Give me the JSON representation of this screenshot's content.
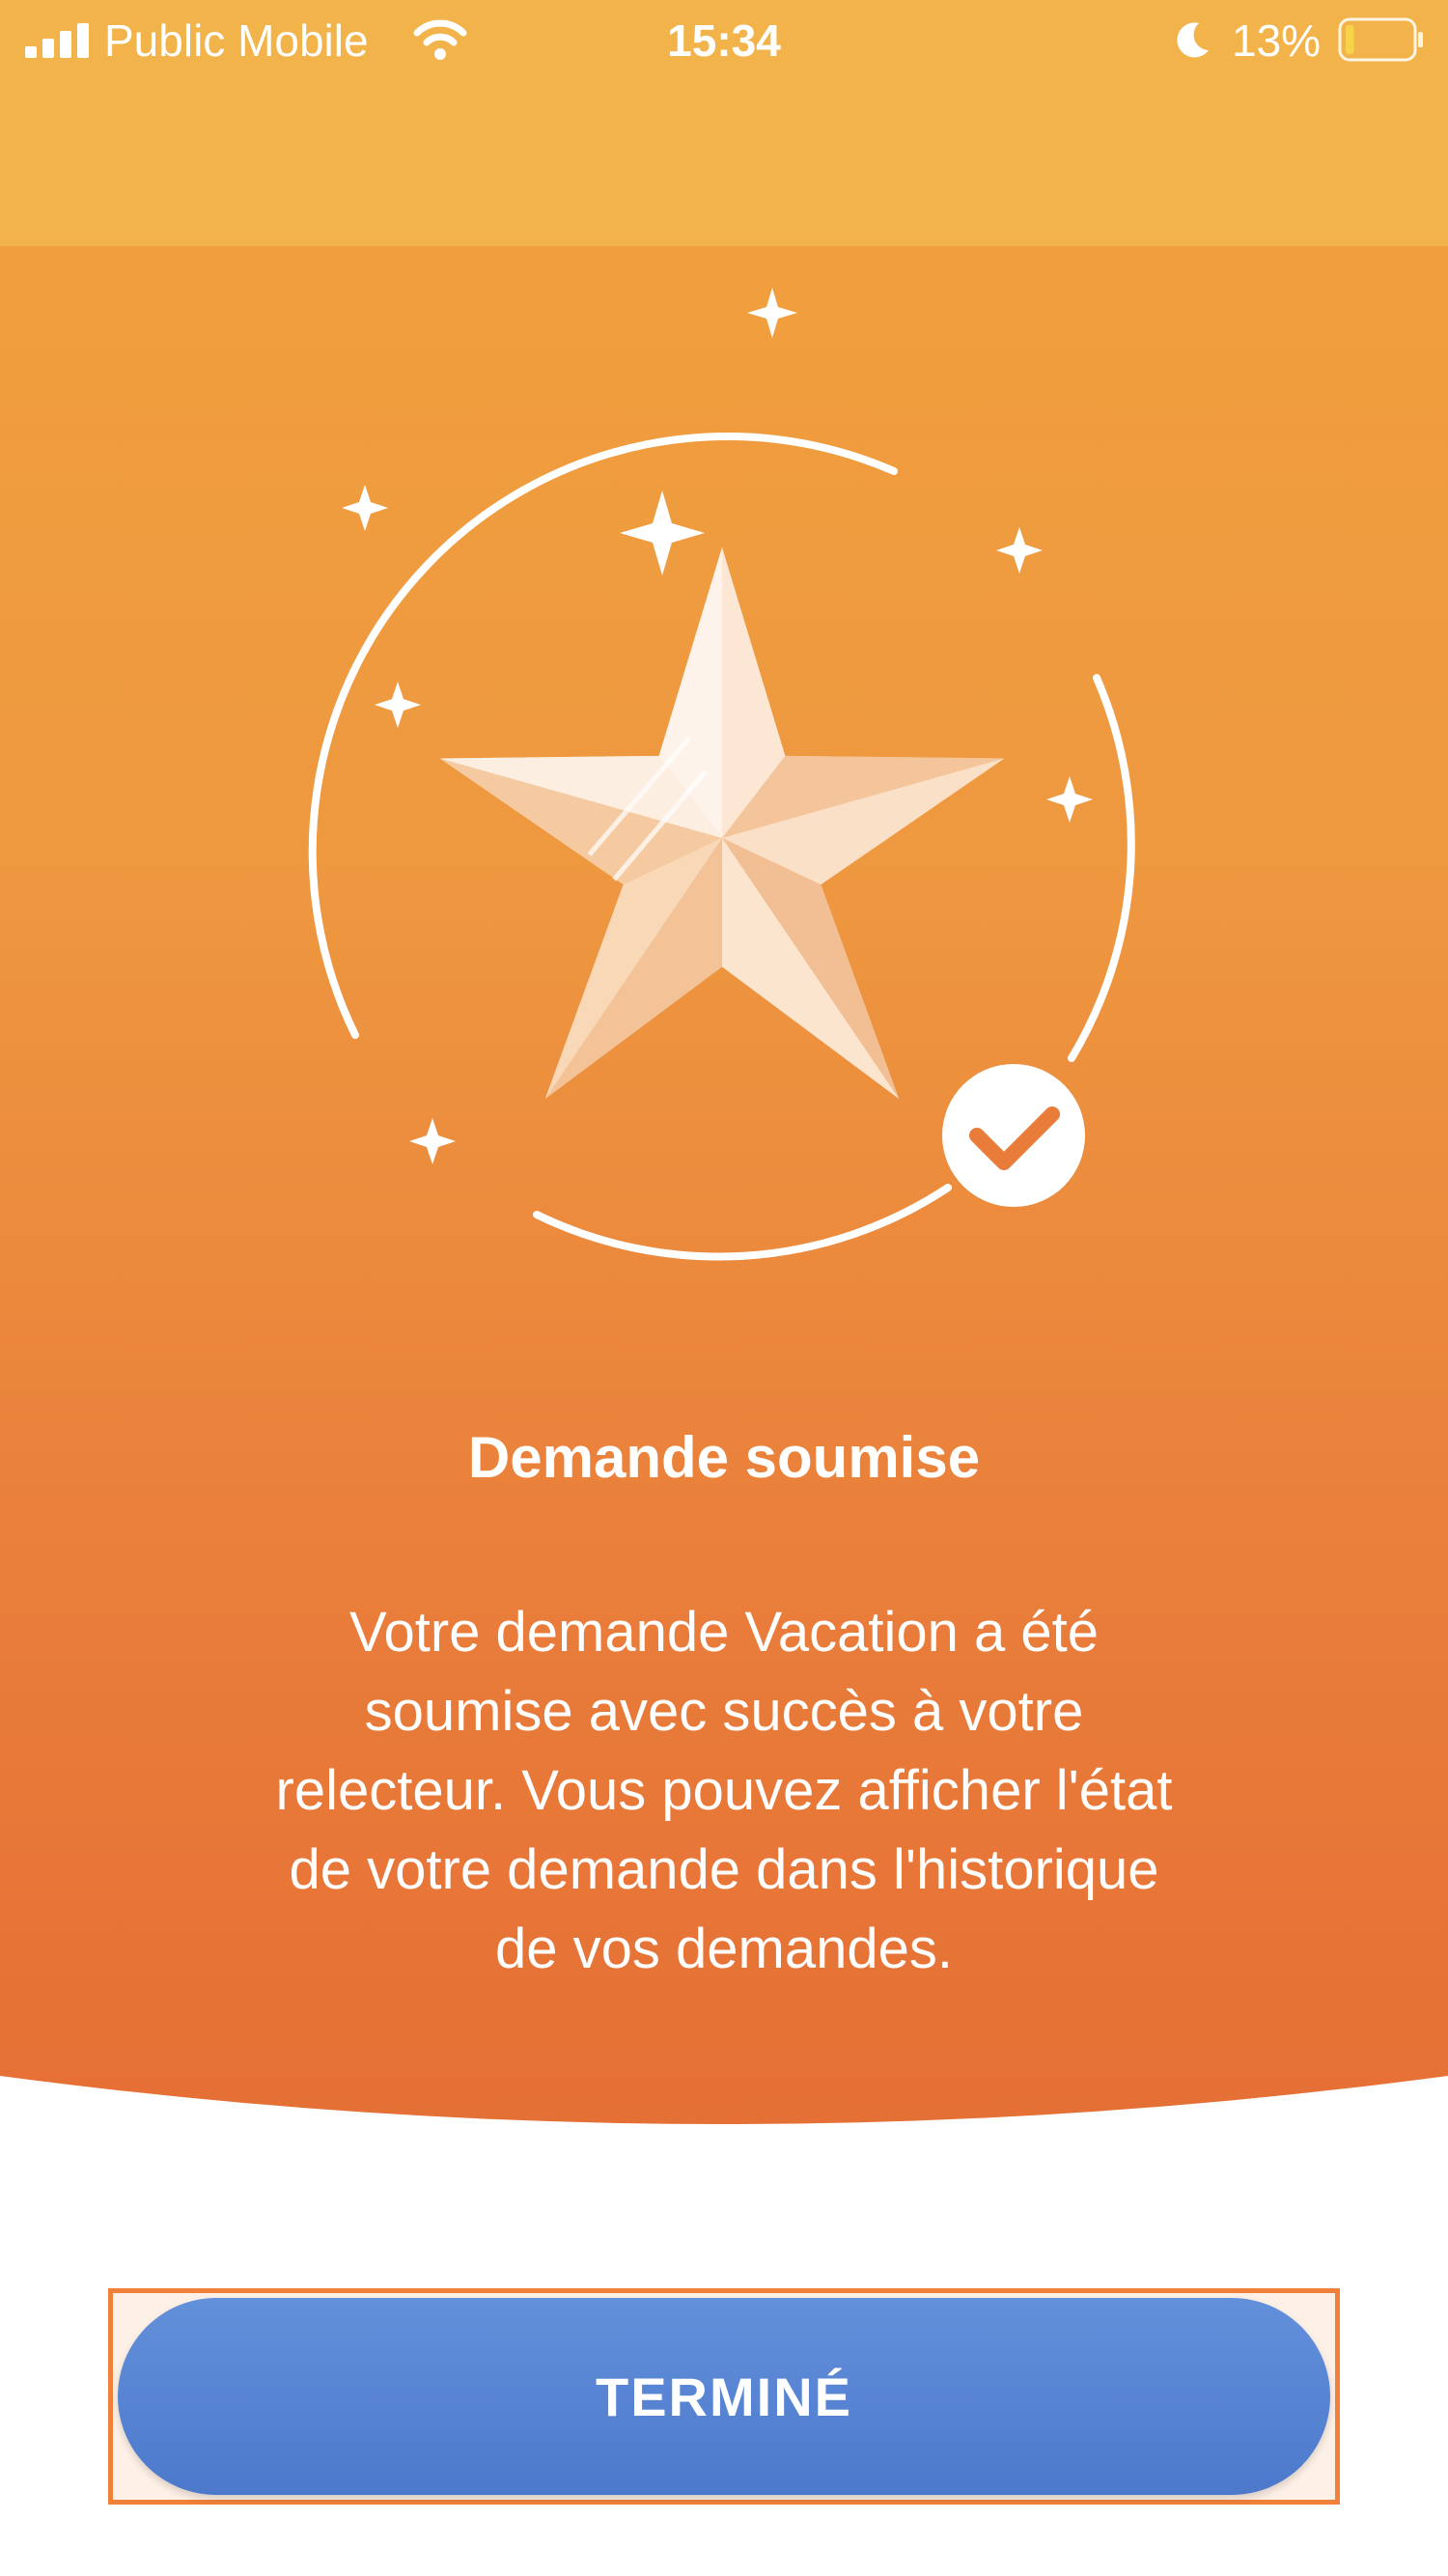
{
  "status_bar": {
    "carrier": "Public Mobile",
    "time": "15:34",
    "battery_percent": "13%",
    "battery_level": 0.13,
    "icons": [
      "signal-icon",
      "wifi-icon",
      "moon-icon",
      "battery-icon"
    ]
  },
  "confirmation": {
    "illustration_icons": [
      "star-icon",
      "sparkle-icon",
      "check-badge-icon"
    ],
    "title": "Demande soumise",
    "message_lines": [
      "Votre demande Vacation a été",
      "soumise avec succès à votre",
      "relecteur. Vous pouvez afficher l'état",
      "de votre demande dans l'historique",
      "de vos demandes."
    ]
  },
  "actions": {
    "done_label": "TERMINÉ"
  },
  "colors": {
    "header": "#F2B44A",
    "gradient_top": "#F1A13D",
    "gradient_bottom": "#E56F35",
    "button": "#5A86D6",
    "highlight_border": "#F0803A"
  }
}
